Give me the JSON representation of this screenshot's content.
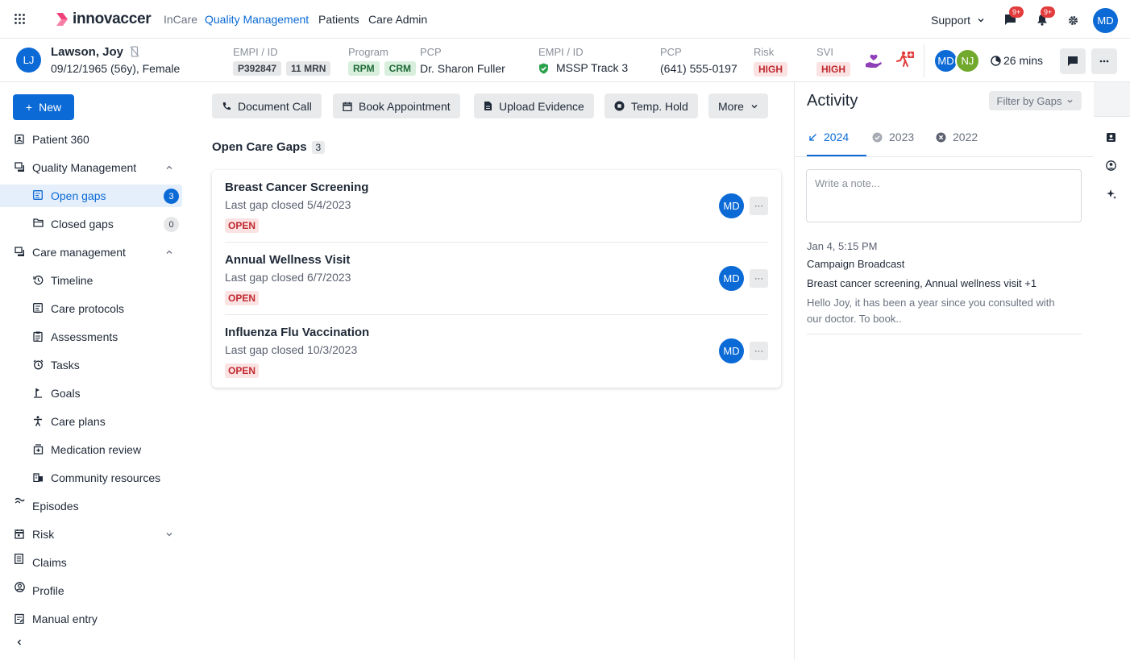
{
  "topnav": {
    "logo": "innovaccer",
    "items": [
      "InCare",
      "Quality Management",
      "Patients",
      "Care Admin"
    ],
    "support_label": "Support",
    "chat_badge": "9+",
    "bell_badge": "9+",
    "user_initials": "MD"
  },
  "patient": {
    "initials": "LJ",
    "name": "Lawson, Joy",
    "dob_info": "09/12/1965 (56y), Female",
    "empi_label": "EMPI / ID",
    "empi_id": "P392847",
    "mrn": "11 MRN",
    "program_label": "Program",
    "program_tags": [
      "RPM",
      "CRM"
    ],
    "pcp_label": "PCP",
    "pcp_name": "Dr. Sharon Fuller",
    "empi2_label": "EMPI / ID",
    "track": "MSSP Track 3",
    "pcp2_label": "PCP",
    "phone": "(641) 555-0197",
    "risk_label": "Risk",
    "risk_value": "HIGH",
    "svi_label": "SVI",
    "svi_value": "HIGH",
    "team_initials": [
      "MD",
      "NJ"
    ],
    "timer": "26 mins"
  },
  "sidebar": {
    "new_label": "New",
    "items": [
      {
        "label": "Patient 360"
      },
      {
        "label": "Quality Management"
      },
      {
        "label": "Open gaps",
        "count": "3"
      },
      {
        "label": "Closed gaps",
        "count": "0"
      },
      {
        "label": "Care management"
      },
      {
        "label": "Timeline"
      },
      {
        "label": "Care protocols"
      },
      {
        "label": "Assessments"
      },
      {
        "label": "Tasks"
      },
      {
        "label": "Goals"
      },
      {
        "label": "Care plans"
      },
      {
        "label": "Medication review"
      },
      {
        "label": "Community resources"
      },
      {
        "label": "Episodes"
      },
      {
        "label": "Risk"
      },
      {
        "label": "Claims"
      },
      {
        "label": "Profile"
      },
      {
        "label": "Manual entry"
      }
    ]
  },
  "actions": {
    "document_call": "Document Call",
    "book_appointment": "Book Appointment",
    "upload_evidence": "Upload Evidence",
    "temp_hold": "Temp. Hold",
    "more": "More"
  },
  "gaps": {
    "title": "Open Care Gaps",
    "count": "3",
    "items": [
      {
        "title": "Breast Cancer Screening",
        "sub": "Last gap closed 5/4/2023",
        "status": "OPEN",
        "owner": "MD"
      },
      {
        "title": "Annual Wellness Visit",
        "sub": "Last gap closed 6/7/2023",
        "status": "OPEN",
        "owner": "MD"
      },
      {
        "title": "Influenza Flu Vaccination",
        "sub": "Last gap closed 10/3/2023",
        "status": "OPEN",
        "owner": "MD"
      }
    ]
  },
  "activity": {
    "title": "Activity",
    "filter_label": "Filter by Gaps",
    "tabs": [
      "2024",
      "2023",
      "2022"
    ],
    "note_placeholder": "Write a note...",
    "feed": {
      "time": "Jan 4, 5:15 PM",
      "title": "Campaign Broadcast",
      "subtitle": "Breast cancer screening, Annual wellness visit +1",
      "body": "Hello Joy, it has been a year since you consulted with our doctor. To book.."
    }
  },
  "colors": {
    "accent": "#0b6ad6",
    "danger": "#c0282e",
    "success": "#1e6a36",
    "avatar_green": "#71a92c"
  }
}
